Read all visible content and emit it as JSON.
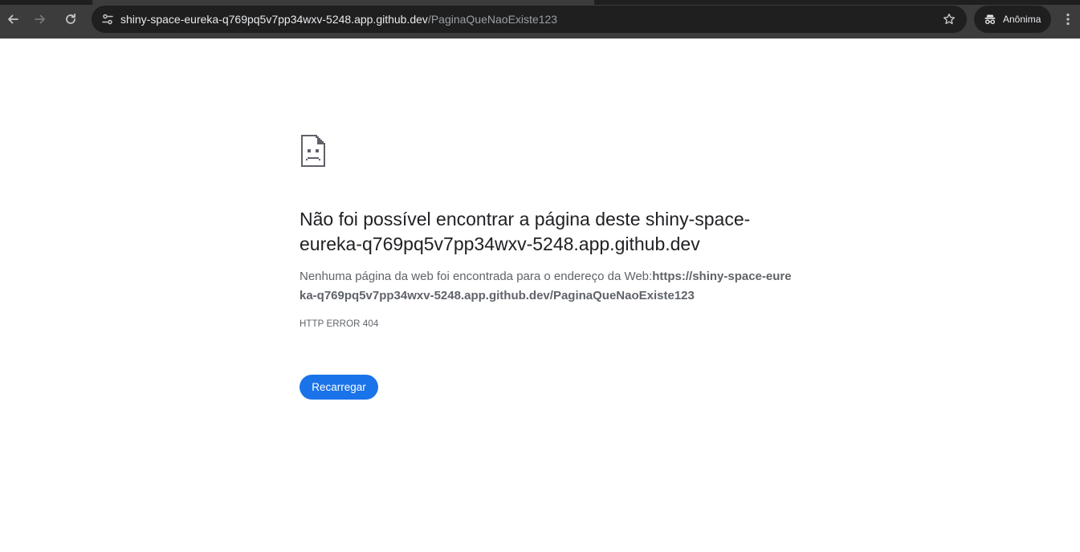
{
  "browser": {
    "url_host": "shiny-space-eureka-q769pq5v7pp34wxv-5248.app.github.dev",
    "url_path": "/PaginaQueNaoExiste123",
    "profile_label": "Anônima",
    "icons": {
      "back": "arrow-left-icon",
      "forward": "arrow-right-icon",
      "reload": "reload-icon",
      "site_info": "tune-icon",
      "bookmark": "star-icon",
      "incognito": "incognito-icon",
      "menu": "more-vert-icon"
    },
    "colors": {
      "toolbar": "#3c3c3c",
      "omnibox": "#1f1f1f"
    }
  },
  "error": {
    "title": "Não foi possível encontrar a página deste shiny-space-eureka-q769pq5v7pp34wxv-5248.app.github.dev",
    "description_prefix": "Nenhuma página da web foi encontrada para o endereço da Web:",
    "description_url": "https://shiny-space-eureka-q769pq5v7pp34wxv-5248.app.github.dev/PaginaQueNaoExiste123",
    "code": "HTTP ERROR 404",
    "reload_label": "Recarregar",
    "icon": "sad-page-icon",
    "colors": {
      "button": "#1a73e8",
      "title": "#202124",
      "text": "#5f6368"
    }
  }
}
